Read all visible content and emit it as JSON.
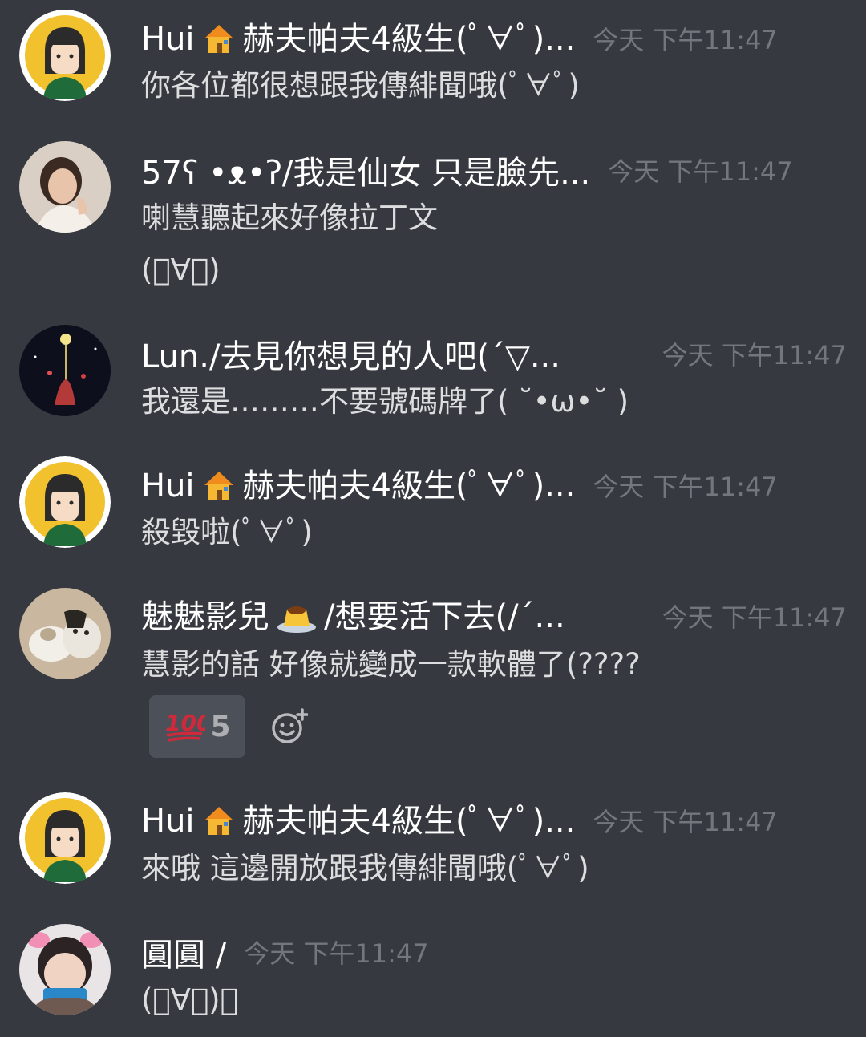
{
  "messages": [
    {
      "author_prefix": "Hui",
      "author_suffix": "赫夫帕夫4級生(ﾟ∀ﾟ)...",
      "timestamp": "今天 下午11:47",
      "lines": [
        "你各位都很想跟我傳緋聞哦(ﾟ∀ﾟ)"
      ]
    },
    {
      "author": "57ʕ •ᴥ•ʔ/我是仙女 只是臉先...",
      "timestamp": "今天 下午11:47",
      "lines": [
        "喇慧聽起來好像拉丁文",
        "(ﾟ∀ﾟ)"
      ]
    },
    {
      "author": "Lun./去見你想見的人吧(´▽...",
      "timestamp": "今天 下午11:47",
      "lines": [
        "我還是………不要號碼牌了( ˘•ω•˘ )"
      ]
    },
    {
      "author_prefix": "Hui",
      "author_suffix": "赫夫帕夫4級生(ﾟ∀ﾟ)...",
      "timestamp": "今天 下午11:47",
      "lines": [
        "殺毀啦(ﾟ∀ﾟ)"
      ]
    },
    {
      "author_prefix": "魅魅影兒",
      "author_suffix": "/想要活下去(/´...",
      "timestamp": "今天 下午11:47",
      "lines": [
        "慧影的話 好像就變成一款軟體了(????"
      ],
      "reaction": {
        "emoji": "100-emoji",
        "count": "5"
      }
    },
    {
      "author_prefix": "Hui",
      "author_suffix": "赫夫帕夫4級生(ﾟ∀ﾟ)...",
      "timestamp": "今天 下午11:47",
      "lines": [
        "來哦 這邊開放跟我傳緋聞哦(ﾟ∀ﾟ)"
      ]
    },
    {
      "author": "圓圓 /",
      "timestamp": "今天 下午11:47",
      "lines": [
        "(ﾟ∀ﾟ)？"
      ]
    }
  ],
  "colors": {
    "background": "#36393f",
    "author": "#ffffff",
    "text": "#dcddde",
    "timestamp": "#72767d",
    "reaction_bg": "#4f545c"
  },
  "icons": [
    "house-emoji-icon",
    "pudding-emoji-icon",
    "100-emoji-icon",
    "add-reaction-icon"
  ]
}
